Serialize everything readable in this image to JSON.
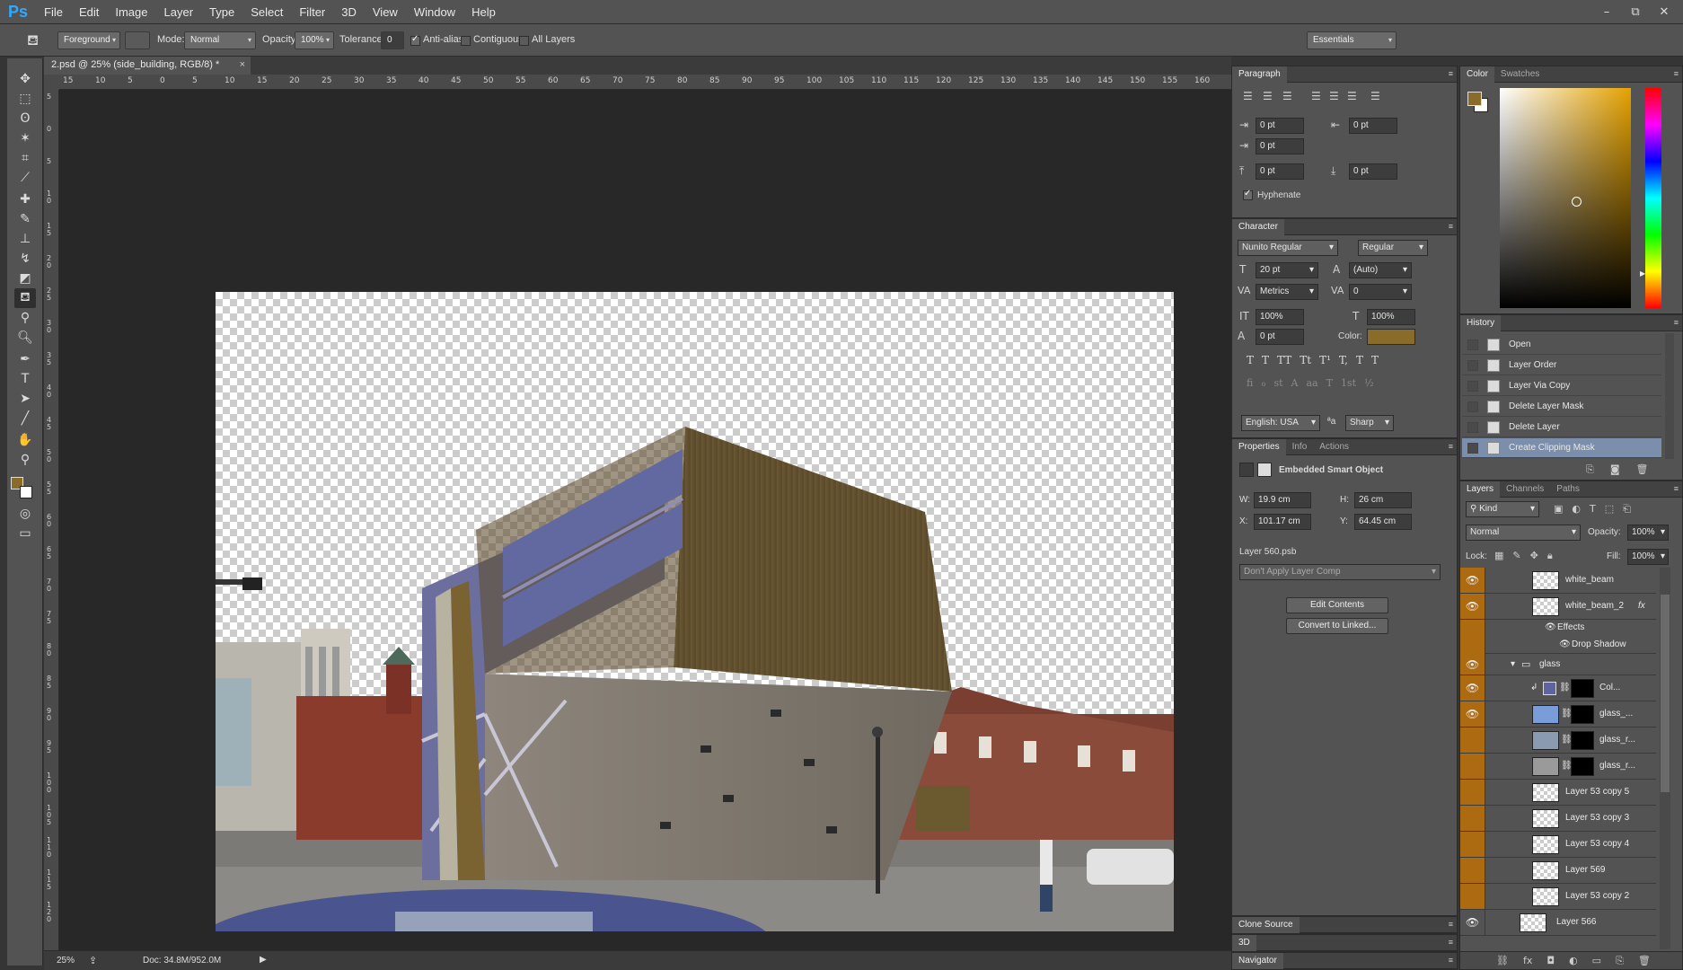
{
  "app": {
    "logo": "Ps"
  },
  "menu": [
    "File",
    "Edit",
    "Image",
    "Layer",
    "Type",
    "Select",
    "Filter",
    "3D",
    "View",
    "Window",
    "Help"
  ],
  "window_controls": [
    "–",
    "⧉",
    "✕"
  ],
  "options": {
    "fill_source": "Foreground",
    "mode_label": "Mode:",
    "mode_value": "Normal",
    "opacity_label": "Opacity:",
    "opacity_value": "100%",
    "tolerance_label": "Tolerance:",
    "tolerance_value": "0",
    "antialias_label": "Anti-alias",
    "contiguous_label": "Contiguous",
    "all_layers_label": "All Layers",
    "workspace": "Essentials"
  },
  "document": {
    "tab_title": "2.psd @ 25% (side_building, RGB/8) *",
    "ruler_top": [
      "15",
      "10",
      "5",
      "0",
      "5",
      "10",
      "15",
      "20",
      "25",
      "30",
      "35",
      "40",
      "45",
      "50",
      "55",
      "60",
      "65",
      "70",
      "75",
      "80",
      "85",
      "90",
      "95",
      "100",
      "105",
      "110",
      "115",
      "120",
      "125",
      "130",
      "135",
      "140",
      "145",
      "150",
      "155",
      "160"
    ],
    "ruler_left": [
      "5",
      "0",
      "5",
      "1 0",
      "1 5",
      "2 0",
      "2 5",
      "3 0",
      "3 5",
      "4 0",
      "4 5",
      "5 0",
      "5 5",
      "6 0",
      "6 5",
      "7 0",
      "7 5",
      "8 0",
      "8 5",
      "9 0",
      "9 5",
      "1 0 0",
      "1 0 5",
      "1 1 0",
      "1 1 5",
      "1 2 0"
    ]
  },
  "status": {
    "zoom": "25%",
    "doc": "Doc: 34.8M/952.0M"
  },
  "paragraph": {
    "title": "Paragraph",
    "indent_left": "0 pt",
    "indent_right": "0 pt",
    "indent_first": "0 pt",
    "space_before": "0 pt",
    "space_after": "0 pt",
    "hyphenate": "Hyphenate"
  },
  "character": {
    "title": "Character",
    "font": "Nunito Regular",
    "style": "Regular",
    "size": "20 pt",
    "leading": "(Auto)",
    "kerning": "Metrics",
    "tracking": "0",
    "vscale": "100%",
    "hscale": "100%",
    "baseline": "0 pt",
    "color_label": "Color:",
    "color": "#8a6c2a",
    "type_buttons": [
      "T",
      "T",
      "TT",
      "Tt",
      "T¹",
      "T,",
      "T",
      "T"
    ],
    "ot_buttons": [
      "fi",
      "ℴ",
      "st",
      "A",
      "aa",
      "T",
      "1st",
      "½"
    ],
    "language": "English: USA",
    "aa_label": "ªa",
    "antialias": "Sharp"
  },
  "properties": {
    "tabs": [
      "Properties",
      "Info",
      "Actions"
    ],
    "kind": "Embedded Smart Object",
    "w_label": "W:",
    "w": "19.9 cm",
    "h_label": "H:",
    "h": "26 cm",
    "x_label": "X:",
    "x": "101.17 cm",
    "y_label": "Y:",
    "y": "64.45 cm",
    "source": "Layer 560.psb",
    "layer_comp": "Don't Apply Layer Comp",
    "edit_contents": "Edit Contents",
    "convert": "Convert to Linked..."
  },
  "collapsed_panels": [
    "Clone Source",
    "3D",
    "Navigator"
  ],
  "color_panel": {
    "tabs": [
      "Color",
      "Swatches"
    ],
    "foreground": "#8a6c2a",
    "background": "#ffffff"
  },
  "history": {
    "title": "History",
    "items": [
      "Open",
      "Layer Order",
      "Layer Via Copy",
      "Delete Layer Mask",
      "Delete Layer",
      "Create Clipping Mask"
    ]
  },
  "layers_panel": {
    "tabs": [
      "Layers",
      "Channels",
      "Paths"
    ],
    "filter": "Kind",
    "blend": "Normal",
    "opacity_label": "Opacity:",
    "opacity": "100%",
    "lock_label": "Lock:",
    "fill_label": "Fill:",
    "fill": "100%",
    "layers": [
      {
        "name": "white_beam",
        "visible": true,
        "highlight": true
      },
      {
        "name": "white_beam_2",
        "visible": true,
        "highlight": true,
        "fx": "fx"
      },
      {
        "name": "Effects",
        "sub": true
      },
      {
        "name": "Drop Shadow",
        "sub2": true
      },
      {
        "name": "glass",
        "visible": true,
        "group": true
      },
      {
        "name": "Col...",
        "visible": true,
        "highlight": true
      },
      {
        "name": "glass_...",
        "visible": true,
        "highlight": true
      },
      {
        "name": "glass_r...",
        "visible": false,
        "highlight": true
      },
      {
        "name": "glass_r...",
        "visible": false,
        "highlight": true
      },
      {
        "name": "Layer 53 copy 5",
        "visible": false,
        "highlight": true
      },
      {
        "name": "Layer 53 copy 3",
        "visible": false,
        "highlight": true
      },
      {
        "name": "Layer 53 copy 4",
        "visible": false,
        "highlight": true
      },
      {
        "name": "Layer 569",
        "visible": false,
        "highlight": true
      },
      {
        "name": "Layer 53 copy 2",
        "visible": false,
        "highlight": true
      },
      {
        "name": "Layer 566",
        "visible": true,
        "highlight": false
      }
    ]
  }
}
